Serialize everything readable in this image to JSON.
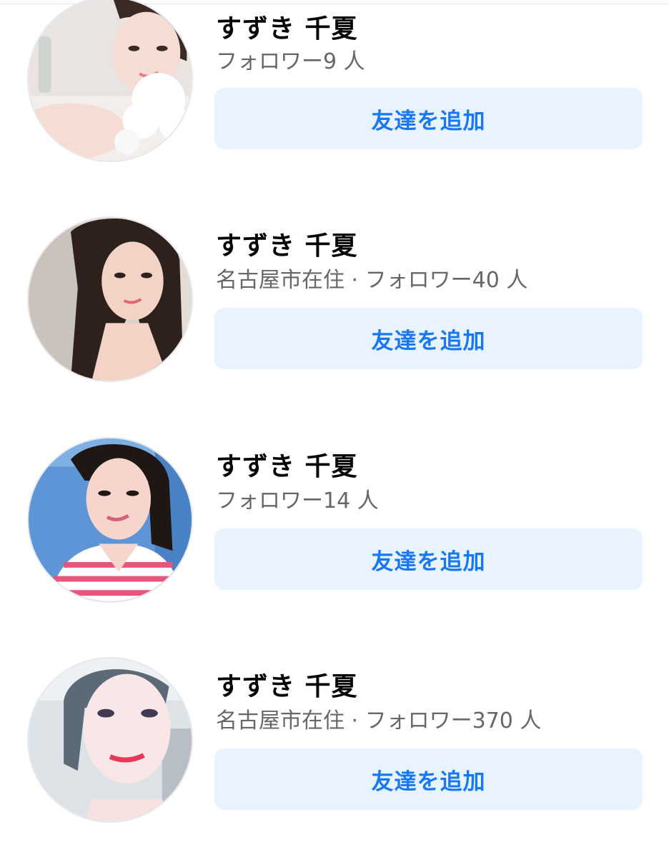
{
  "people": [
    {
      "name": "すずき 千夏",
      "subtitle": "フォロワー9 人",
      "add_label": "友達を追加",
      "avatar_palette": {
        "bg": "#e9e4e2",
        "skin": "#f6ddd3",
        "hair": "#3a2a24",
        "accent": "#ffffff"
      }
    },
    {
      "name": "すずき 千夏",
      "subtitle": "名古屋市在住 · フォロワー40 人",
      "add_label": "友達を追加",
      "avatar_palette": {
        "bg": "#d8d2cc",
        "skin": "#f2d3c6",
        "hair": "#2e201b",
        "accent": "#b9a9a0"
      }
    },
    {
      "name": "すずき 千夏",
      "subtitle": "フォロワー14 人",
      "add_label": "友達を追加",
      "avatar_palette": {
        "bg": "#5d95d6",
        "skin": "#f6d6cc",
        "hair": "#1f1714",
        "accent": "#e7567a"
      }
    },
    {
      "name": "すずき 千夏",
      "subtitle": "名古屋市在住 · フォロワー370 人",
      "add_label": "友達を追加",
      "avatar_palette": {
        "bg": "#dde2e6",
        "skin": "#f8e7e6",
        "hair": "#5c6a78",
        "accent": "#e6395a"
      }
    }
  ],
  "colors": {
    "button_bg": "#e7f3ff",
    "button_text": "#1877f2",
    "name_text": "#050505",
    "subtitle_text": "#65676b"
  }
}
